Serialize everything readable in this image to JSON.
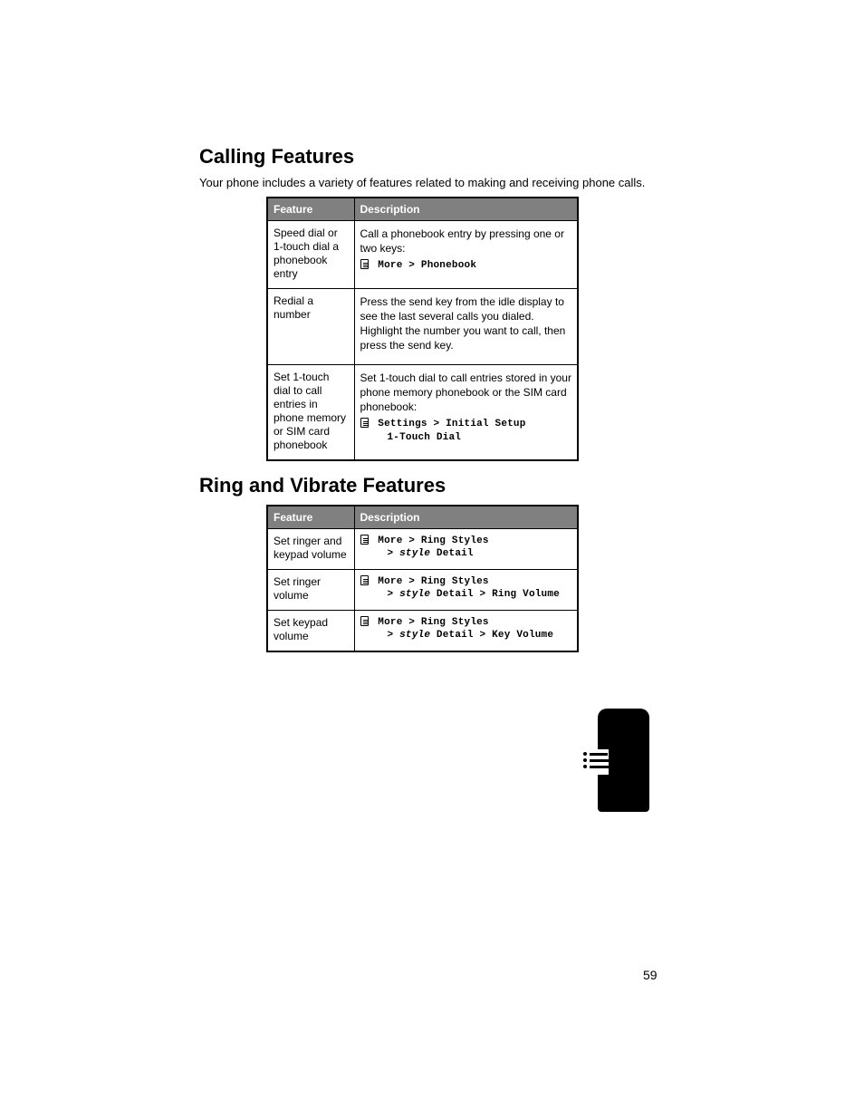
{
  "section1": {
    "heading": "Calling Features",
    "lead": "Your phone includes a variety of features related to making and receiving phone calls.",
    "table": {
      "head_feature": "Feature",
      "head_desc": "Description",
      "rows": [
        {
          "feature": "Speed dial or 1-touch dial a phonebook entry",
          "desc": "Call a phonebook entry by pressing one or two keys:",
          "path": [
            {
              "icon": true,
              "segments": [
                "More",
                "Phonebook"
              ],
              "indent": false
            }
          ]
        },
        {
          "feature": "Redial a number",
          "desc": "Press the send key from the idle display to see the last several calls you dialed. Highlight the number you want to call, then press the send key.",
          "path": []
        },
        {
          "feature": "Set 1-touch dial to call entries in phone memory or SIM card phonebook",
          "desc": "Set 1-touch dial to call entries stored in your phone memory phonebook or the SIM card phonebook:",
          "path": [
            {
              "icon": true,
              "segments": [
                "Settings",
                "Initial Setup"
              ],
              "indent": false
            },
            {
              "icon": false,
              "segments": [
                "1-Touch Dial"
              ],
              "indent": true
            }
          ]
        }
      ]
    }
  },
  "section2": {
    "heading": "Ring and Vibrate Features",
    "table": {
      "head_feature": "Feature",
      "head_desc": "Description",
      "rows": [
        {
          "feature": "Set ringer and keypad volume",
          "desc": "",
          "path": [
            {
              "icon": true,
              "segments": [
                "More",
                "Ring Styles"
              ],
              "indent": false
            },
            {
              "icon": false,
              "segments": [
                "Detail"
              ],
              "indent": true,
              "prefix_style_gt": true
            }
          ]
        },
        {
          "feature": "Set ringer volume",
          "desc": "",
          "path": [
            {
              "icon": true,
              "segments": [
                "More",
                "Ring Styles"
              ],
              "indent": false
            },
            {
              "icon": false,
              "segments": [
                "Detail",
                "Ring Volume"
              ],
              "indent": true,
              "prefix_style_gt": true
            }
          ]
        },
        {
          "feature": "Set keypad volume",
          "desc": "",
          "path": [
            {
              "icon": true,
              "segments": [
                "More",
                "Ring Styles"
              ],
              "indent": false
            },
            {
              "icon": false,
              "segments": [
                "Detail",
                "Key Volume"
              ],
              "indent": true,
              "prefix_style_gt": true
            }
          ]
        }
      ]
    }
  },
  "page_number": "59"
}
